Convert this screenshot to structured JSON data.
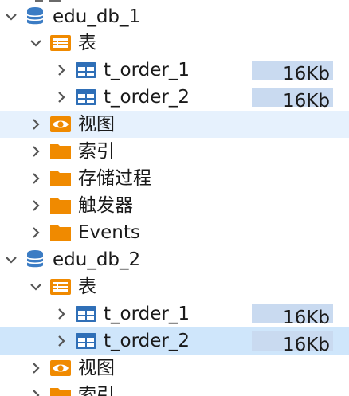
{
  "colors": {
    "accent_db": "#3b7cc4",
    "folder": "#f08a00",
    "table_icon": "#2f6fb7",
    "selected_row": "#cfe6fb",
    "hover_row": "#e6f1fd",
    "size_bar": "#c9daf0"
  },
  "tree": {
    "databases": [
      {
        "name": "edu_db_1",
        "icon": "database-icon",
        "expanded": true,
        "tables_folder": {
          "label": "表",
          "icon": "table-folder-icon",
          "expanded": true,
          "tables": [
            {
              "name": "t_order_1",
              "size": "16Kb",
              "icon": "table-icon"
            },
            {
              "name": "t_order_2",
              "size": "16Kb",
              "icon": "table-icon"
            }
          ]
        },
        "folders": [
          {
            "label": "视图",
            "icon": "view-eye-icon"
          },
          {
            "label": "索引",
            "icon": "folder-icon"
          },
          {
            "label": "存储过程",
            "icon": "folder-icon"
          },
          {
            "label": "触发器",
            "icon": "folder-icon"
          },
          {
            "label": "Events",
            "icon": "folder-icon"
          }
        ]
      },
      {
        "name": "edu_db_2",
        "icon": "database-icon",
        "expanded": true,
        "tables_folder": {
          "label": "表",
          "icon": "table-folder-icon",
          "expanded": true,
          "tables": [
            {
              "name": "t_order_1",
              "size": "16Kb",
              "icon": "table-icon"
            },
            {
              "name": "t_order_2",
              "size": "16Kb",
              "icon": "table-icon"
            }
          ]
        },
        "folders": [
          {
            "label": "视图",
            "icon": "view-eye-icon"
          },
          {
            "label": "索引",
            "icon": "folder-icon"
          }
        ]
      }
    ]
  }
}
